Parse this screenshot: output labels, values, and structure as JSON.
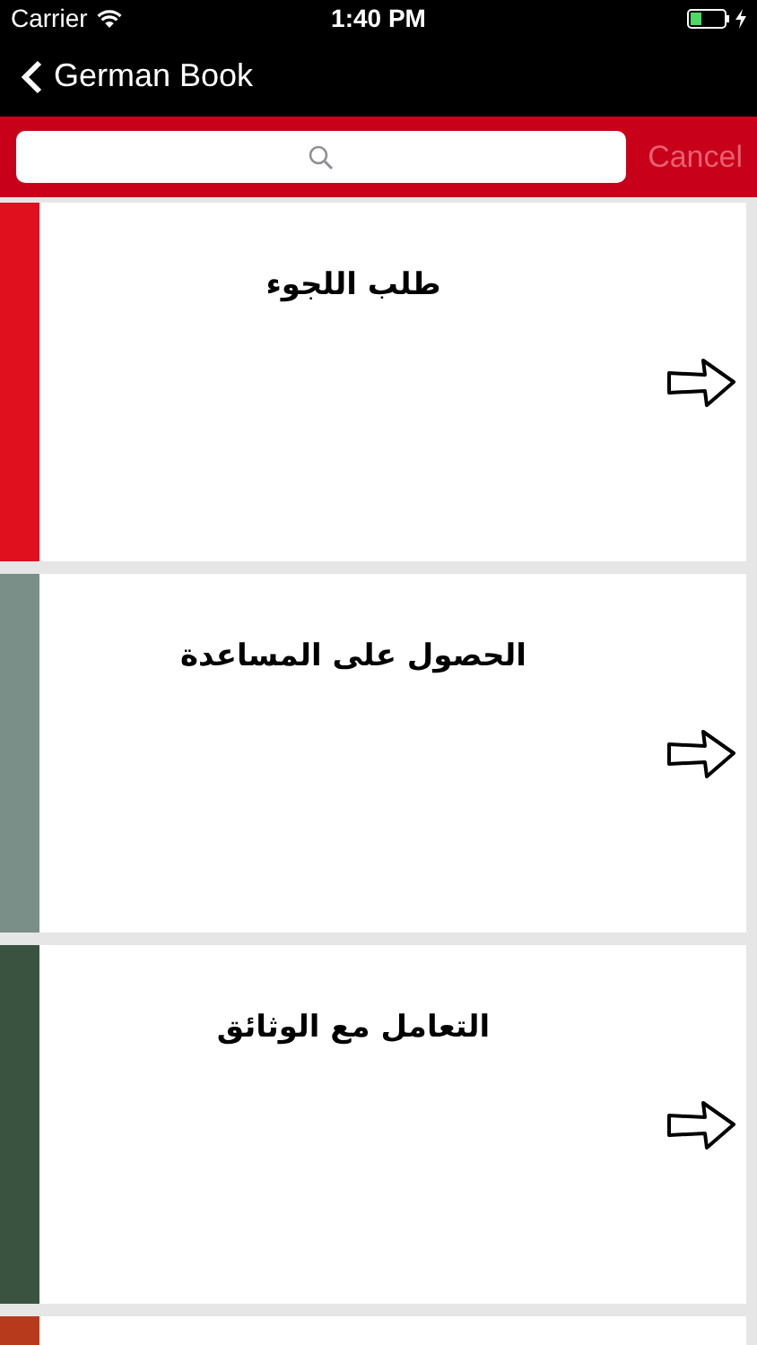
{
  "status_bar": {
    "carrier": "Carrier",
    "time": "1:40 PM"
  },
  "nav": {
    "back_label": "German Book"
  },
  "search": {
    "cancel": "Cancel"
  },
  "items": [
    {
      "title": "طلب اللجوء",
      "color": "#e0101f"
    },
    {
      "title": "الحصول على المساعدة",
      "color": "#7a8f88"
    },
    {
      "title": "التعامل مع الوثائق",
      "color": "#3a5340"
    },
    {
      "color": "#b83a1c"
    }
  ]
}
